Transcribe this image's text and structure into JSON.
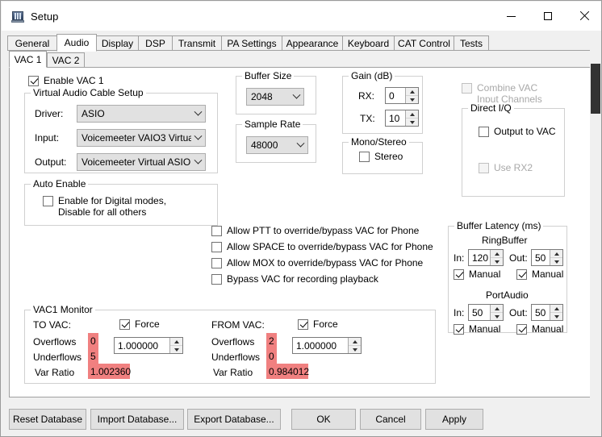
{
  "window": {
    "title": "Setup",
    "icon": "app-setup-icon",
    "minimize_label": "Minimize",
    "maximize_label": "Maximize",
    "close_label": "Close"
  },
  "tabs": [
    {
      "label": "General",
      "active": false
    },
    {
      "label": "Audio",
      "active": true
    },
    {
      "label": "Display",
      "active": false
    },
    {
      "label": "DSP",
      "active": false
    },
    {
      "label": "Transmit",
      "active": false
    },
    {
      "label": "PA Settings",
      "active": false
    },
    {
      "label": "Appearance",
      "active": false
    },
    {
      "label": "Keyboard",
      "active": false
    },
    {
      "label": "CAT Control",
      "active": false
    },
    {
      "label": "Tests",
      "active": false
    }
  ],
  "subtabs": [
    {
      "label": "VAC 1",
      "active": true
    },
    {
      "label": "VAC 2",
      "active": false
    }
  ],
  "enable_vac": {
    "label": "Enable VAC 1",
    "checked": true
  },
  "vac_setup": {
    "title": "Virtual Audio Cable Setup",
    "driver_label": "Driver:",
    "driver_value": "ASIO",
    "input_label": "Input:",
    "input_value": "Voicemeeter VAIO3 Virtual A",
    "output_label": "Output:",
    "output_value": "Voicemeeter Virtual ASIO"
  },
  "auto_enable": {
    "title": "Auto Enable",
    "checkbox_label": "Enable for Digital modes, Disable for all others",
    "checked": false
  },
  "buffer_size": {
    "title": "Buffer Size",
    "value": "2048"
  },
  "sample_rate": {
    "title": "Sample Rate",
    "value": "48000"
  },
  "gain": {
    "title": "Gain (dB)",
    "rx_label": "RX:",
    "rx_value": "0",
    "tx_label": "TX:",
    "tx_value": "10"
  },
  "mono_stereo": {
    "title": "Mono/Stereo",
    "stereo_label": "Stereo",
    "stereo_checked": false
  },
  "combine_vac": {
    "label": "Combine VAC Input Channels",
    "checked": false,
    "disabled": true
  },
  "direct_iq": {
    "title": "Direct I/Q",
    "output_label": "Output to VAC",
    "output_checked": false,
    "userx2_label": "Use RX2",
    "userx2_checked": false,
    "userx2_disabled": true
  },
  "overrides": [
    {
      "label": "Allow PTT to override/bypass VAC for Phone",
      "checked": false
    },
    {
      "label": "Allow SPACE to override/bypass VAC for Phone",
      "checked": false
    },
    {
      "label": "Allow MOX to override/bypass VAC for Phone",
      "checked": false
    },
    {
      "label": "Bypass VAC for recording playback",
      "checked": false
    }
  ],
  "buffer_latency": {
    "title": "Buffer Latency (ms)",
    "ringbuffer_label": "RingBuffer",
    "ring_in_label": "In:",
    "ring_in_value": "120",
    "ring_out_label": "Out:",
    "ring_out_value": "50",
    "ring_in_manual_label": "Manual",
    "ring_in_manual_checked": true,
    "ring_out_manual_label": "Manual",
    "ring_out_manual_checked": true,
    "portaudio_label": "PortAudio",
    "pa_in_label": "In:",
    "pa_in_value": "50",
    "pa_out_label": "Out:",
    "pa_out_value": "50",
    "pa_in_manual_label": "Manual",
    "pa_in_manual_checked": true,
    "pa_out_manual_label": "Manual",
    "pa_out_manual_checked": true
  },
  "monitor": {
    "title": "VAC1 Monitor",
    "to_vac": {
      "heading": "TO VAC:",
      "overflows_label": "Overflows",
      "overflows_value": "0",
      "underflows_label": "Underflows",
      "underflows_value": "5",
      "var_ratio_label": "Var Ratio",
      "var_ratio_value": "1.002360",
      "force_label": "Force",
      "force_checked": true,
      "force_value": "1.000000",
      "highlight_color": "#f08080"
    },
    "from_vac": {
      "heading": "FROM VAC:",
      "overflows_label": "Overflows",
      "overflows_value": "2",
      "underflows_label": "Underflows",
      "underflows_value": "0",
      "var_ratio_label": "Var Ratio",
      "var_ratio_value": "0.984012",
      "force_label": "Force",
      "force_checked": true,
      "force_value": "1.000000",
      "highlight_color": "#f08080"
    }
  },
  "footer": {
    "reset_database": "Reset Database",
    "import_database": "Import Database...",
    "export_database": "Export Database...",
    "ok": "OK",
    "cancel": "Cancel",
    "apply": "Apply"
  }
}
